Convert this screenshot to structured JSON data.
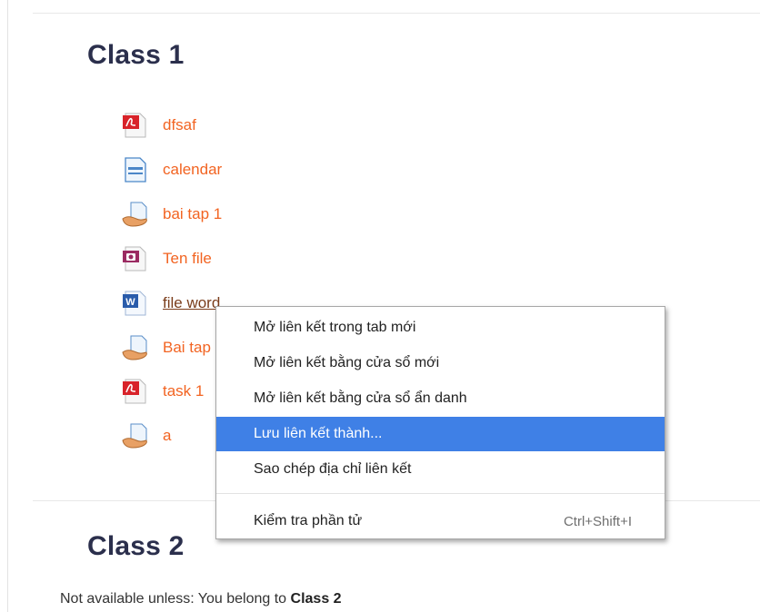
{
  "sections": [
    {
      "title": "Class 1",
      "activities": [
        {
          "name": "dfsaf",
          "icon": "pdf-file-icon"
        },
        {
          "name": "calendar",
          "icon": "page-resource-icon"
        },
        {
          "name": "bai tap 1",
          "icon": "assignment-icon"
        },
        {
          "name": "Ten file",
          "icon": "image-file-icon"
        },
        {
          "name": "file word",
          "icon": "word-file-icon"
        },
        {
          "name": "Bai tap",
          "icon": "assignment-icon"
        },
        {
          "name": "task 1",
          "icon": "pdf-file-icon"
        },
        {
          "name": "a",
          "icon": "assignment-icon"
        }
      ]
    },
    {
      "title": "Class 2",
      "restriction": {
        "prefix": "Not available unless: You belong to ",
        "group": "Class 2"
      }
    }
  ],
  "context_menu": {
    "items": [
      {
        "label": "Mở liên kết trong tab mới"
      },
      {
        "label": "Mở liên kết bằng cửa sổ mới"
      },
      {
        "label": "Mở liên kết bằng cửa sổ ẩn danh"
      },
      {
        "label": "Lưu liên kết thành...",
        "selected": true
      },
      {
        "label": "Sao chép địa chỉ liên kết"
      },
      {
        "label": "Kiểm tra phần tử",
        "shortcut": "Ctrl+Shift+I"
      }
    ],
    "selected_color": "#3f80e6"
  },
  "colors": {
    "link": "#f26422",
    "heading": "#2b2f4c"
  }
}
